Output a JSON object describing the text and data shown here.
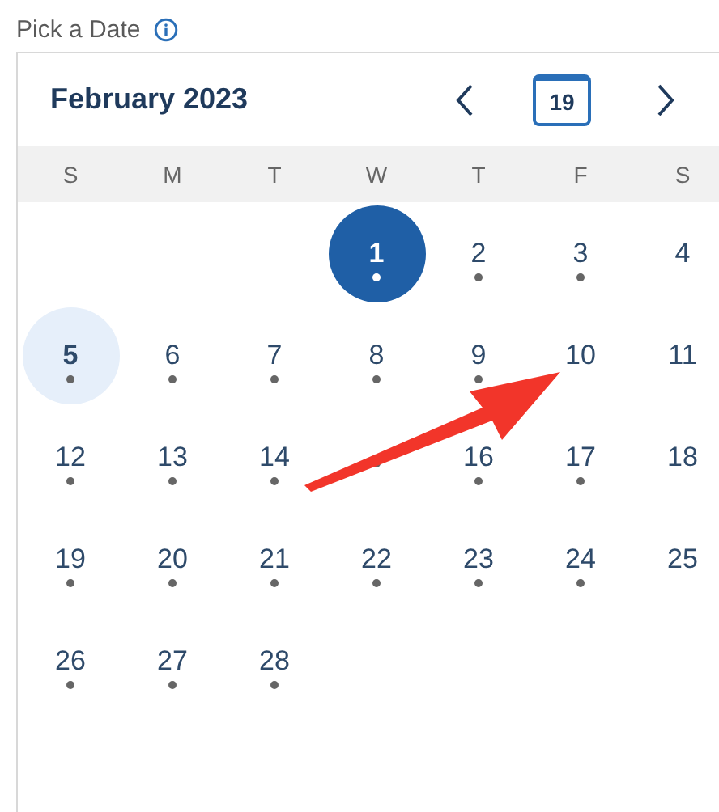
{
  "field_label": "Pick a Date",
  "calendar": {
    "month_title": "February 2023",
    "today_button": "19",
    "weekdays": [
      "S",
      "M",
      "T",
      "W",
      "T",
      "F",
      "S"
    ],
    "weeks": [
      [
        {
          "label": "1",
          "marked": true,
          "selected": true,
          "focused": false
        },
        {
          "label": "2",
          "marked": true,
          "selected": false,
          "focused": false
        },
        {
          "label": "3",
          "marked": true,
          "selected": false,
          "focused": false
        },
        {
          "label": "4",
          "marked": false,
          "selected": false,
          "focused": false
        }
      ],
      [
        {
          "label": "5",
          "marked": true,
          "selected": false,
          "focused": true
        },
        {
          "label": "6",
          "marked": true,
          "selected": false,
          "focused": false
        },
        {
          "label": "7",
          "marked": true,
          "selected": false,
          "focused": false
        },
        {
          "label": "8",
          "marked": true,
          "selected": false,
          "focused": false
        },
        {
          "label": "9",
          "marked": true,
          "selected": false,
          "focused": false
        },
        {
          "label": "10",
          "marked": false,
          "selected": false,
          "focused": false
        },
        {
          "label": "11",
          "marked": false,
          "selected": false,
          "focused": false
        }
      ],
      [
        {
          "label": "12",
          "marked": true,
          "selected": false,
          "focused": false
        },
        {
          "label": "13",
          "marked": true,
          "selected": false,
          "focused": false
        },
        {
          "label": "14",
          "marked": true,
          "selected": false,
          "focused": false
        },
        {
          "marked": true,
          "selected": false,
          "focused": false
        },
        {
          "label": "16",
          "marked": true,
          "selected": false,
          "focused": false
        },
        {
          "label": "17",
          "marked": true,
          "selected": false,
          "focused": false
        },
        {
          "label": "18",
          "marked": false,
          "selected": false,
          "focused": false
        }
      ],
      [
        {
          "label": "19",
          "marked": true,
          "selected": false,
          "focused": false
        },
        {
          "label": "20",
          "marked": true,
          "selected": false,
          "focused": false
        },
        {
          "label": "21",
          "marked": true,
          "selected": false,
          "focused": false
        },
        {
          "label": "22",
          "marked": true,
          "selected": false,
          "focused": false
        },
        {
          "label": "23",
          "marked": true,
          "selected": false,
          "focused": false
        },
        {
          "label": "24",
          "marked": true,
          "selected": false,
          "focused": false
        },
        {
          "label": "25",
          "marked": false,
          "selected": false,
          "focused": false
        }
      ],
      [
        {
          "label": "26",
          "marked": true,
          "selected": false,
          "focused": false
        },
        {
          "label": "27",
          "marked": true,
          "selected": false,
          "focused": false
        },
        {
          "label": "28",
          "marked": true,
          "selected": false,
          "focused": false
        }
      ]
    ]
  }
}
